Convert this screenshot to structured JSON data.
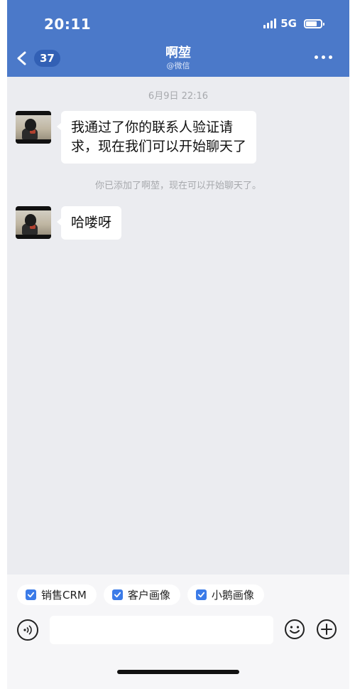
{
  "status_bar": {
    "time": "20:11",
    "network": "5G"
  },
  "header": {
    "back_badge": "37",
    "title": "啊堃",
    "subtitle": "@微信",
    "more_icon": "more-dots-icon"
  },
  "chat": {
    "timestamp": "6月9日 22:16",
    "messages": [
      {
        "line1": "我通过了你的联系人验证请",
        "line2": "求，现在我们可以开始聊天了"
      },
      {
        "text": "哈喽呀"
      }
    ],
    "system_notice": "你已添加了啊堃，现在可以开始聊天了。"
  },
  "quick_actions": [
    {
      "label": "销售CRM"
    },
    {
      "label": "客户画像"
    },
    {
      "label": "小鹅画像"
    }
  ],
  "input": {
    "value": "",
    "placeholder": ""
  },
  "colors": {
    "header": "#4b79c9",
    "badge": "#3260b5",
    "chat_bg": "#ebecf0",
    "chip_check": "#3b7be8"
  }
}
